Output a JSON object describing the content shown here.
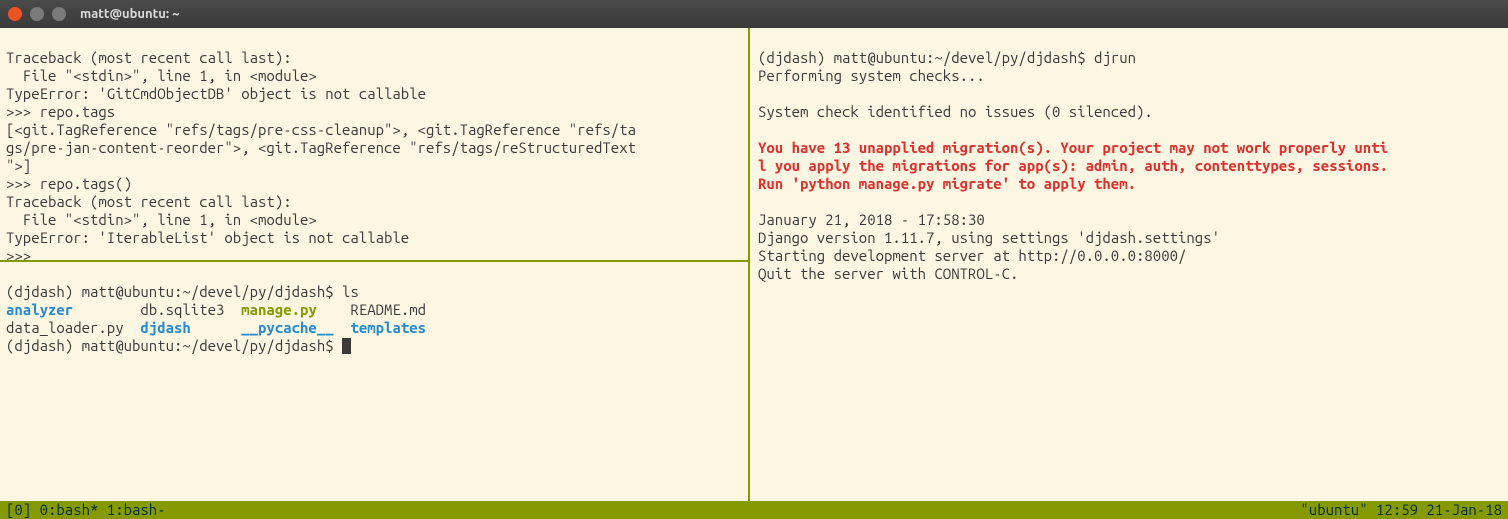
{
  "window": {
    "title": "matt@ubuntu: ~"
  },
  "topleft": {
    "l1": "Traceback (most recent call last):",
    "l2": "  File \"<stdin>\", line 1, in <module>",
    "l3": "TypeError: 'GitCmdObjectDB' object is not callable",
    "l4": ">>> repo.tags",
    "l5": "[<git.TagReference \"refs/tags/pre-css-cleanup\">, <git.TagReference \"refs/ta",
    "l6": "gs/pre-jan-content-reorder\">, <git.TagReference \"refs/tags/reStructuredText",
    "l7": "\">]",
    "l8": ">>> repo.tags()",
    "l9": "Traceback (most recent call last):",
    "l10": "  File \"<stdin>\", line 1, in <module>",
    "l11": "TypeError: 'IterableList' object is not callable",
    "l12": ">>>"
  },
  "bottomleft": {
    "prompt1_env": "(djdash) ",
    "prompt1_userhost": "matt@ubuntu",
    "prompt1_sep": ":",
    "prompt1_path": "~/devel/py/djdash",
    "prompt1_end": "$ ",
    "prompt1_cmd": "ls",
    "ls_analyzer": "analyzer",
    "ls_db": "db.sqlite3",
    "ls_manage": "manage.py",
    "ls_readme": "README.md",
    "ls_loader": "data_loader.py",
    "ls_djdash": "djdash",
    "ls_pycache": "__pycache__",
    "ls_templates": "templates",
    "prompt2_env": "(djdash) ",
    "prompt2_userhost": "matt@ubuntu",
    "prompt2_sep": ":",
    "prompt2_path": "~/devel/py/djdash",
    "prompt2_end": "$ "
  },
  "right": {
    "prompt_env": "(djdash) ",
    "prompt_userhost": "matt@ubuntu",
    "prompt_sep": ":",
    "prompt_path": "~/devel/py/djdash",
    "prompt_end": "$ ",
    "prompt_cmd": "djrun",
    "l2": "Performing system checks...",
    "l4": "System check identified no issues (0 silenced).",
    "warn1": "You have 13 unapplied migration(s). Your project may not work properly unti",
    "warn2": "l you apply the migrations for app(s): admin, auth, contenttypes, sessions.",
    "warn3": "Run 'python manage.py migrate' to apply them.",
    "l9": "January 21, 2018 - 17:58:30",
    "l10": "Django version 1.11.7, using settings 'djdash.settings'",
    "l11": "Starting development server at http://0.0.0.0:8000/",
    "l12": "Quit the server with CONTROL-C."
  },
  "status": {
    "left": "[0] 0:bash* 1:bash-",
    "right": "\"ubuntu\" 12:59 21-Jan-18"
  }
}
